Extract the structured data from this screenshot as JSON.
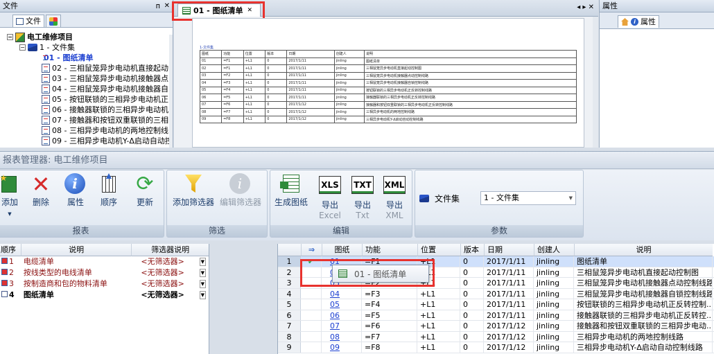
{
  "left_panel": {
    "title": "文件",
    "pin": "ᴨ",
    "close": "✕",
    "tab_label": "文件",
    "tree": {
      "root": "电工维修项目",
      "folder": "1 - 文件集",
      "items": [
        "01 - 图纸清单",
        "02 - 三相鼠笼异步电动机直接起动",
        "03 - 三相鼠笼异步电动机接触器点",
        "04 - 三相鼠笼异步电动机接触器自",
        "05 - 按钮联锁的三相异步电动机正",
        "06 - 接触器联锁的三相异步电动机",
        "07 - 接触器和按钮双重联锁的三相",
        "08 - 三相异步电动机的两地控制线",
        "09 - 三相异步电动机Y-Δ启动自动控"
      ]
    }
  },
  "doc_tab": {
    "label": "01 - 图纸清单",
    "close": "✕",
    "nav": "◂ ▸ ✕"
  },
  "pdf": {
    "caption": "1-文件集",
    "headers": [
      "图纸",
      "功能",
      "位置",
      "版本",
      "日期",
      "创建人",
      "说明"
    ],
    "rows": [
      [
        "01",
        "=F1",
        "+L1",
        "0",
        "2017/1/11",
        "jinling",
        "图纸清单"
      ],
      [
        "02",
        "=F1",
        "+L1",
        "0",
        "2017/1/11",
        "jinling",
        "三相鼠笼异步电动机直接起动控制图"
      ],
      [
        "03",
        "=F2",
        "+L1",
        "0",
        "2017/1/11",
        "jinling",
        "三相鼠笼异步电动机接触器点动控制线路"
      ],
      [
        "04",
        "=F3",
        "+L1",
        "0",
        "2017/1/11",
        "jinling",
        "三相鼠笼异步电动机接触器自锁控制线路"
      ],
      [
        "05",
        "=F4",
        "+L1",
        "0",
        "2017/1/11",
        "jinling",
        "按钮联锁的三相异步电动机正反转控制线路"
      ],
      [
        "06",
        "=F5",
        "+L1",
        "0",
        "2017/1/11",
        "jinling",
        "接触器联锁的三相异步电动机正反转控制线路"
      ],
      [
        "07",
        "=F6",
        "+L1",
        "0",
        "2017/1/12",
        "jinling",
        "接触器和按钮双重联锁的三相异步电动机正反转控制线路"
      ],
      [
        "08",
        "=F7",
        "+L1",
        "0",
        "2017/1/12",
        "jinling",
        "三相异步电动机的两地控制线路"
      ],
      [
        "09",
        "=F8",
        "+L1",
        "0",
        "2017/1/12",
        "jinling",
        "三相异步电动机Y-Δ启动自动控制线路"
      ]
    ]
  },
  "right_panel": {
    "title": "属性",
    "tab_label": "属性"
  },
  "manager_title": "报表管理器: 电工维修项目",
  "ribbon": {
    "groups": [
      {
        "label": "报表"
      },
      {
        "label": "筛选"
      },
      {
        "label": "编辑"
      },
      {
        "label": "参数"
      }
    ],
    "buttons": {
      "add": "添加",
      "delete": "删除",
      "properties": "属性",
      "order": "顺序",
      "refresh": "更新",
      "add_filter": "添加筛选器",
      "edit_filter": "编辑筛选器",
      "generate": "生成图纸",
      "export_xls": "导出",
      "export_xls_sub": "Excel",
      "export_txt": "导出",
      "export_txt_sub": "Txt",
      "export_xml": "导出",
      "export_xml_sub": "XML",
      "xls_icon": "XLS",
      "txt_icon": "TXT",
      "xml_icon": "XML"
    },
    "param_label": "文件集",
    "param_value": "1 - 文件集"
  },
  "report_list": {
    "headers": [
      "顺序",
      "说明",
      "筛选器说明"
    ],
    "rows": [
      {
        "order": "1",
        "desc": "电缆清单",
        "filter": "<无筛选器>"
      },
      {
        "order": "2",
        "desc": "按线类型的电线清单",
        "filter": "<无筛选器>"
      },
      {
        "order": "3",
        "desc": "按制造商和包的物料清单",
        "filter": "<无筛选器>"
      },
      {
        "order": "4",
        "desc": "图纸清单",
        "filter": "<无筛选器>"
      }
    ]
  },
  "drawing_grid": {
    "headers": [
      "图纸",
      "功能",
      "位置",
      "版本",
      "日期",
      "创建人",
      "说明"
    ],
    "rows": [
      [
        "1",
        "01",
        "=F1",
        "+L1",
        "0",
        "2017/1/11",
        "jinling",
        "图纸清单"
      ],
      [
        "2",
        "02",
        "=F1",
        "+L1",
        "0",
        "2017/1/11",
        "jinling",
        "三相鼠笼异步电动机直接起动控制图"
      ],
      [
        "3",
        "03",
        "=F2",
        "+L1",
        "0",
        "2017/1/11",
        "jinling",
        "三相鼠笼异步电动机接触器点动控制线路"
      ],
      [
        "4",
        "04",
        "=F3",
        "+L1",
        "0",
        "2017/1/11",
        "jinling",
        "三相鼠笼异步电动机接触器自锁控制线路"
      ],
      [
        "5",
        "05",
        "=F4",
        "+L1",
        "0",
        "2017/1/11",
        "jinling",
        "按钮联锁的三相异步电动机正反转控制..."
      ],
      [
        "6",
        "06",
        "=F5",
        "+L1",
        "0",
        "2017/1/11",
        "jinling",
        "接触器联锁的三相异步电动机正反转控..."
      ],
      [
        "7",
        "07",
        "=F6",
        "+L1",
        "0",
        "2017/1/12",
        "jinling",
        "接触器和按钮双重联锁的三相异步电动..."
      ],
      [
        "8",
        "08",
        "=F7",
        "+L1",
        "0",
        "2017/1/12",
        "jinling",
        "三相异步电动机的两地控制线路"
      ],
      [
        "9",
        "09",
        "=F8",
        "+L1",
        "0",
        "2017/1/12",
        "jinling",
        "三相异步电动机Y-Δ启动自动控制线路"
      ]
    ],
    "tooltip": "01 - 图纸清单"
  },
  "colors": {
    "highlight": "#e8322e",
    "accent": "#1a3ed0",
    "selection": "#cfe0fb"
  }
}
